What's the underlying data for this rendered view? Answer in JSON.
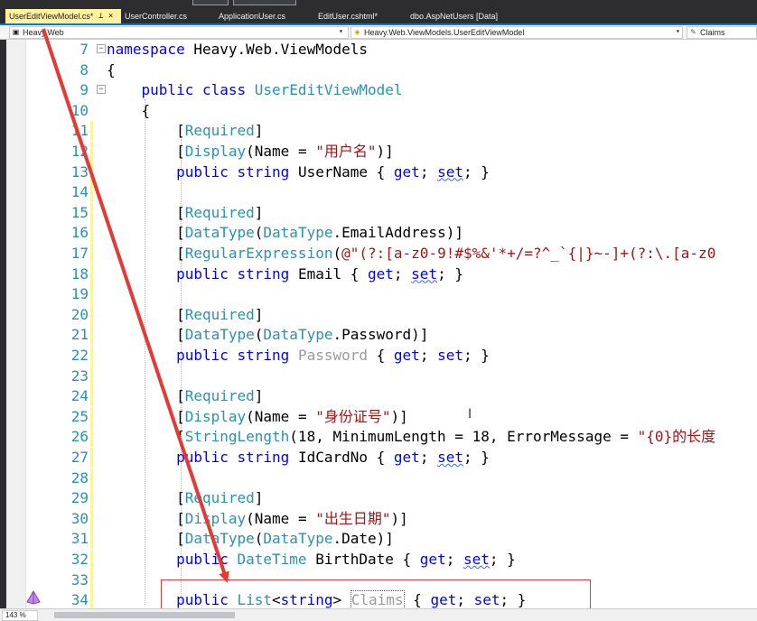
{
  "tabs": [
    {
      "label": "UserEditViewModel.cs*",
      "active": true
    },
    {
      "label": "UserController.cs",
      "active": false
    },
    {
      "label": "ApplicationUser.cs",
      "active": false
    },
    {
      "label": "EditUser.cshtml*",
      "active": false
    },
    {
      "label": "dbo.AspNetUsers [Data]",
      "active": false
    }
  ],
  "tab_close_glyphs": "⊥ ×",
  "nav": {
    "project": "Heavy.Web",
    "type": "Heavy.Web.ViewModels.UserEditViewModel",
    "member": "Claims"
  },
  "code_lines": [
    {
      "n": "7",
      "segments": [
        {
          "t": "namespace",
          "c": "kw"
        },
        {
          "t": " Heavy.Web.ViewModels",
          "c": ""
        }
      ]
    },
    {
      "n": "8",
      "segments": [
        {
          "t": "{",
          "c": ""
        }
      ]
    },
    {
      "n": "9",
      "segments": [
        {
          "t": "    public ",
          "c": "kw"
        },
        {
          "t": "class ",
          "c": "kw"
        },
        {
          "t": "UserEditViewModel",
          "c": "ty"
        }
      ]
    },
    {
      "n": "10",
      "segments": [
        {
          "t": "    {",
          "c": ""
        }
      ]
    },
    {
      "n": "11",
      "segments": [
        {
          "t": "        [",
          "c": ""
        },
        {
          "t": "Required",
          "c": "ty"
        },
        {
          "t": "]",
          "c": ""
        }
      ]
    },
    {
      "n": "12",
      "segments": [
        {
          "t": "        [",
          "c": ""
        },
        {
          "t": "Display",
          "c": "ty"
        },
        {
          "t": "(Name = ",
          "c": ""
        },
        {
          "t": "\"用户名\"",
          "c": "str"
        },
        {
          "t": ")]",
          "c": ""
        }
      ]
    },
    {
      "n": "13",
      "segments": [
        {
          "t": "        public ",
          "c": "kw"
        },
        {
          "t": "string ",
          "c": "kw"
        },
        {
          "t": "UserName { ",
          "c": ""
        },
        {
          "t": "get",
          "c": "kw"
        },
        {
          "t": "; ",
          "c": ""
        },
        {
          "t": "set",
          "c": "kw squig"
        },
        {
          "t": "; }",
          "c": ""
        }
      ]
    },
    {
      "n": "14",
      "segments": []
    },
    {
      "n": "15",
      "segments": [
        {
          "t": "        [",
          "c": ""
        },
        {
          "t": "Required",
          "c": "ty"
        },
        {
          "t": "]",
          "c": ""
        }
      ]
    },
    {
      "n": "16",
      "segments": [
        {
          "t": "        [",
          "c": ""
        },
        {
          "t": "DataType",
          "c": "ty"
        },
        {
          "t": "(",
          "c": ""
        },
        {
          "t": "DataType",
          "c": "ty"
        },
        {
          "t": ".EmailAddress)]",
          "c": ""
        }
      ]
    },
    {
      "n": "17",
      "segments": [
        {
          "t": "        [",
          "c": ""
        },
        {
          "t": "RegularExpression",
          "c": "ty"
        },
        {
          "t": "(",
          "c": ""
        },
        {
          "t": "@\"(?:[a-z0-9!#$%&'*+/=?^_`{|}~-]+(?:\\.[a-z0",
          "c": "str"
        }
      ]
    },
    {
      "n": "18",
      "segments": [
        {
          "t": "        public ",
          "c": "kw"
        },
        {
          "t": "string ",
          "c": "kw"
        },
        {
          "t": "Email { ",
          "c": ""
        },
        {
          "t": "get",
          "c": "kw"
        },
        {
          "t": "; ",
          "c": ""
        },
        {
          "t": "set",
          "c": "kw squig"
        },
        {
          "t": "; }",
          "c": ""
        }
      ]
    },
    {
      "n": "19",
      "segments": []
    },
    {
      "n": "20",
      "segments": [
        {
          "t": "        [",
          "c": ""
        },
        {
          "t": "Required",
          "c": "ty"
        },
        {
          "t": "]",
          "c": ""
        }
      ]
    },
    {
      "n": "21",
      "segments": [
        {
          "t": "        [",
          "c": ""
        },
        {
          "t": "DataType",
          "c": "ty"
        },
        {
          "t": "(",
          "c": ""
        },
        {
          "t": "DataType",
          "c": "ty"
        },
        {
          "t": ".Password)]",
          "c": ""
        }
      ]
    },
    {
      "n": "22",
      "segments": [
        {
          "t": "        public ",
          "c": "kw"
        },
        {
          "t": "string ",
          "c": "kw"
        },
        {
          "t": "Password",
          "c": "dim"
        },
        {
          "t": " { ",
          "c": ""
        },
        {
          "t": "get",
          "c": "kw"
        },
        {
          "t": "; ",
          "c": ""
        },
        {
          "t": "set",
          "c": "kw"
        },
        {
          "t": "; }",
          "c": ""
        }
      ]
    },
    {
      "n": "23",
      "segments": []
    },
    {
      "n": "24",
      "segments": [
        {
          "t": "        [",
          "c": ""
        },
        {
          "t": "Required",
          "c": "ty"
        },
        {
          "t": "]",
          "c": ""
        }
      ]
    },
    {
      "n": "25",
      "segments": [
        {
          "t": "        [",
          "c": ""
        },
        {
          "t": "Display",
          "c": "ty"
        },
        {
          "t": "(Name = ",
          "c": ""
        },
        {
          "t": "\"身份证号\"",
          "c": "str"
        },
        {
          "t": ")]",
          "c": ""
        }
      ]
    },
    {
      "n": "26",
      "segments": [
        {
          "t": "        [",
          "c": ""
        },
        {
          "t": "StringLength",
          "c": "ty"
        },
        {
          "t": "(18, MinimumLength = 18, ErrorMessage = ",
          "c": ""
        },
        {
          "t": "\"{0}的长度",
          "c": "str"
        }
      ]
    },
    {
      "n": "27",
      "segments": [
        {
          "t": "        public ",
          "c": "kw"
        },
        {
          "t": "string ",
          "c": "kw"
        },
        {
          "t": "IdCardNo { ",
          "c": ""
        },
        {
          "t": "get",
          "c": "kw"
        },
        {
          "t": "; ",
          "c": ""
        },
        {
          "t": "set",
          "c": "kw squig"
        },
        {
          "t": "; }",
          "c": ""
        }
      ]
    },
    {
      "n": "28",
      "segments": []
    },
    {
      "n": "29",
      "segments": [
        {
          "t": "        [",
          "c": ""
        },
        {
          "t": "Required",
          "c": "ty"
        },
        {
          "t": "]",
          "c": ""
        }
      ]
    },
    {
      "n": "30",
      "segments": [
        {
          "t": "        [",
          "c": ""
        },
        {
          "t": "Display",
          "c": "ty"
        },
        {
          "t": "(Name = ",
          "c": ""
        },
        {
          "t": "\"出生日期\"",
          "c": "str"
        },
        {
          "t": ")]",
          "c": ""
        }
      ]
    },
    {
      "n": "31",
      "segments": [
        {
          "t": "        [",
          "c": ""
        },
        {
          "t": "DataType",
          "c": "ty"
        },
        {
          "t": "(",
          "c": ""
        },
        {
          "t": "DataType",
          "c": "ty"
        },
        {
          "t": ".Date)]",
          "c": ""
        }
      ]
    },
    {
      "n": "32",
      "segments": [
        {
          "t": "        public ",
          "c": "kw"
        },
        {
          "t": "DateTime ",
          "c": "ty"
        },
        {
          "t": "BirthDate { ",
          "c": ""
        },
        {
          "t": "get",
          "c": "kw"
        },
        {
          "t": "; ",
          "c": ""
        },
        {
          "t": "set",
          "c": "kw squig"
        },
        {
          "t": "; }",
          "c": ""
        }
      ]
    },
    {
      "n": "33",
      "segments": []
    },
    {
      "n": "34",
      "segments": [
        {
          "t": "        public ",
          "c": "kw"
        },
        {
          "t": "List",
          "c": "ty"
        },
        {
          "t": "<",
          "c": ""
        },
        {
          "t": "string",
          "c": "kw"
        },
        {
          "t": "> ",
          "c": ""
        },
        {
          "t": "Claims",
          "c": "claims-box"
        },
        {
          "t": " { ",
          "c": ""
        },
        {
          "t": "get",
          "c": "kw"
        },
        {
          "t": "; ",
          "c": ""
        },
        {
          "t": "set",
          "c": "kw"
        },
        {
          "t": "; }",
          "c": ""
        }
      ]
    }
  ],
  "changed_lines": [
    "11",
    "12",
    "13",
    "14",
    "15",
    "16",
    "17",
    "18",
    "19",
    "20",
    "21",
    "22",
    "23",
    "24",
    "25",
    "26",
    "27",
    "28",
    "29",
    "30",
    "31",
    "32",
    "33",
    "34"
  ],
  "outline_lines": {
    "7": "−",
    "9": "−"
  },
  "zoom": "143 %",
  "colors": {
    "keyword": "#0000ff",
    "type": "#2b91af",
    "string": "#a31515",
    "annotation": "#e53935",
    "active_tab": "#fff29d"
  }
}
